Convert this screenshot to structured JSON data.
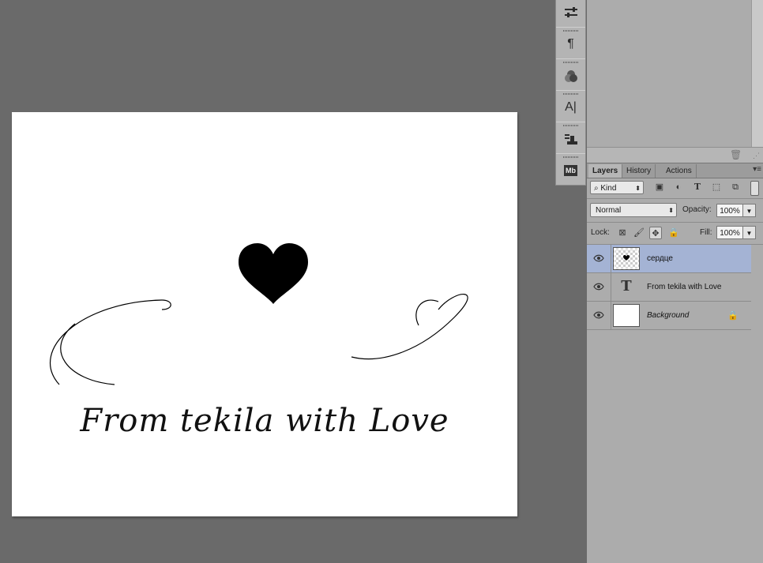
{
  "canvas": {
    "text": "From tekila with Love"
  },
  "icon_strip": {
    "items": [
      {
        "icon": "brush-presets-icon"
      },
      {
        "icon": "paragraph-icon"
      },
      {
        "icon": "channels-icon"
      },
      {
        "icon": "character-icon"
      },
      {
        "icon": "clone-source-icon"
      },
      {
        "icon": "mini-bridge-icon"
      }
    ],
    "paragraph_glyph": "¶",
    "character_glyph": "A|",
    "mb_glyph": "Mb"
  },
  "layers_panel": {
    "tabs": [
      {
        "label": "Layers",
        "active": true
      },
      {
        "label": "History",
        "active": false
      },
      {
        "label": "Actions",
        "active": false
      }
    ],
    "filter": {
      "label": "Kind"
    },
    "blend_mode": "Normal",
    "opacity_label": "Opacity:",
    "opacity_value": "100%",
    "lock_label": "Lock:",
    "fill_label": "Fill:",
    "fill_value": "100%",
    "layers": [
      {
        "name": "сердце",
        "type": "shape",
        "selected": true,
        "visible": true
      },
      {
        "name": "From tekila with Love",
        "type": "text",
        "selected": false,
        "visible": true
      },
      {
        "name": "Background",
        "type": "background",
        "selected": false,
        "visible": true,
        "locked": true
      }
    ],
    "text_layer_glyph": "T"
  },
  "colors": {
    "workspace": "#6a6a6a",
    "panel": "#acacac",
    "selected_layer": "#a4b3d4"
  }
}
